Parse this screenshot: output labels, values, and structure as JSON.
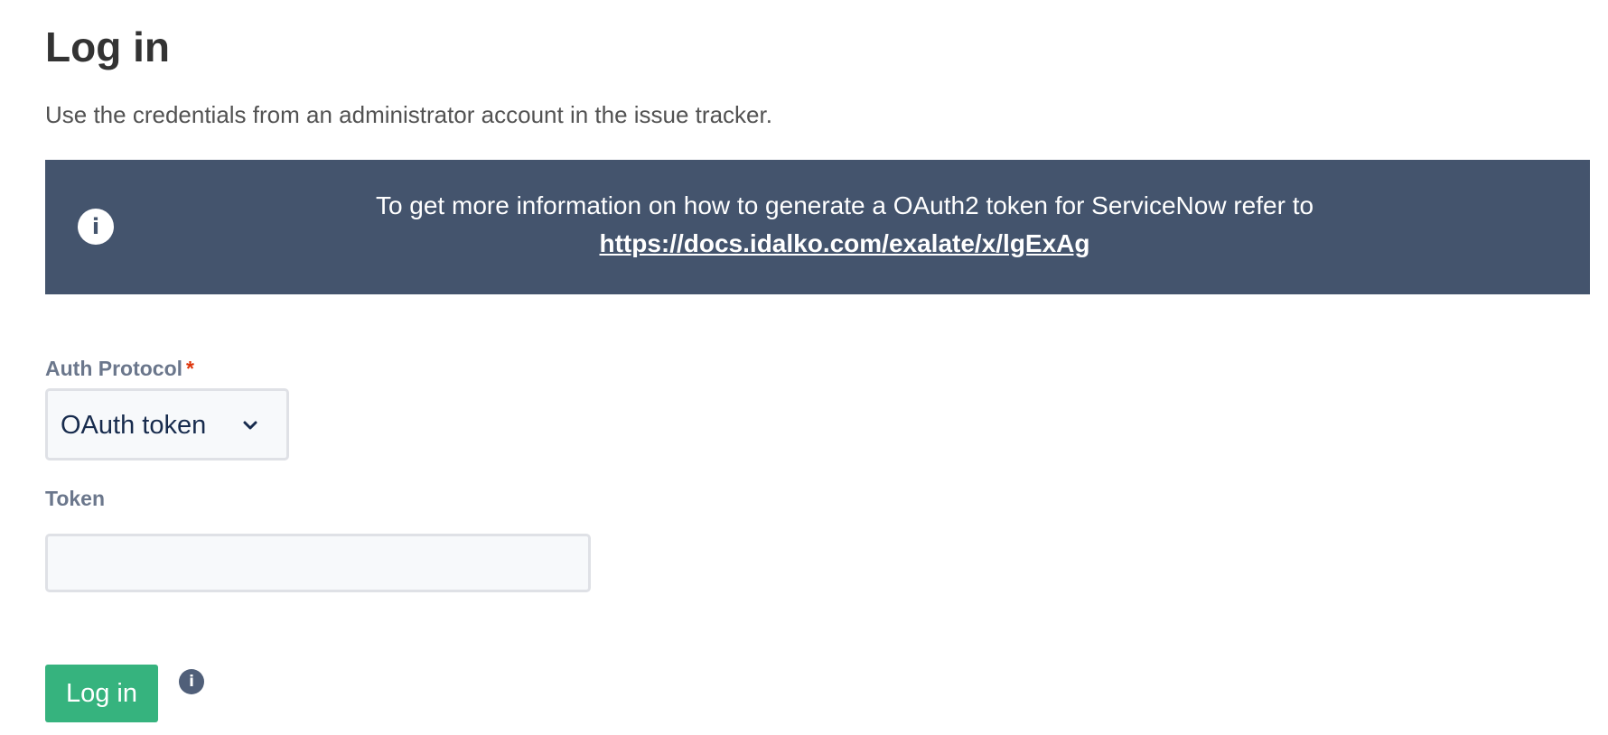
{
  "page": {
    "title": "Log in",
    "subtitle": "Use the credentials from an administrator account in the issue tracker."
  },
  "banner": {
    "icon": "info-icon",
    "text": "To get more information on how to generate a OAuth2 token for ServiceNow refer to",
    "link": "https://docs.idalko.com/exalate/x/lgExAg",
    "background_color": "#44546d"
  },
  "form": {
    "auth_protocol": {
      "label": "Auth Protocol",
      "required_mark": "*",
      "selected_value": "OAuth token",
      "icon": "chevron-down-icon"
    },
    "token": {
      "label": "Token",
      "value": "",
      "placeholder": ""
    },
    "submit": {
      "label": "Log in",
      "color": "#36b37e"
    },
    "help_icon": {
      "icon": "info-icon",
      "glyph": "i"
    }
  }
}
